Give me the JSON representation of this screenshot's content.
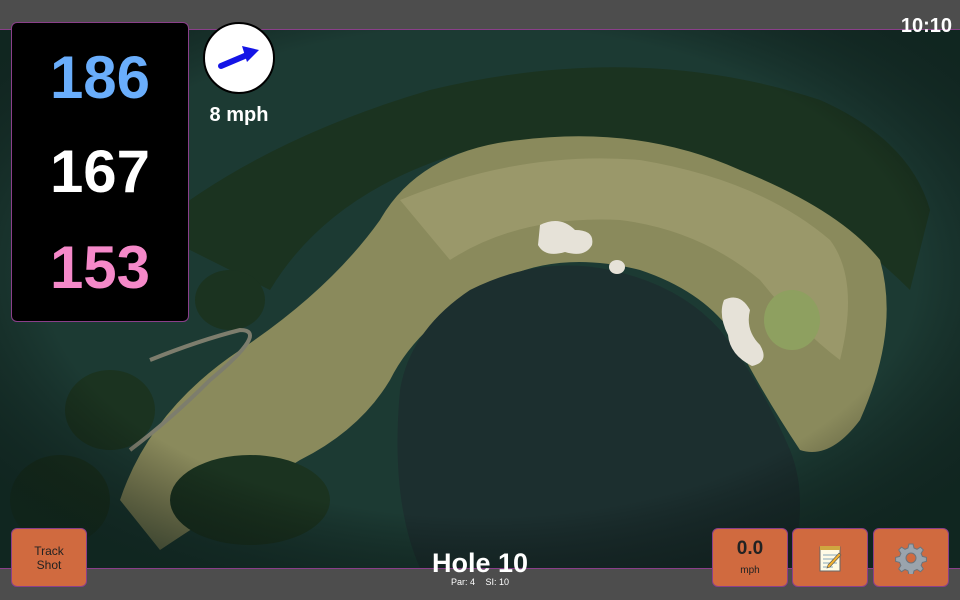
{
  "clock": "10:10",
  "distances": {
    "back": "186",
    "middle": "167",
    "front": "153"
  },
  "wind": {
    "speed": "8 mph",
    "icon": "wind-arrow-icon"
  },
  "buttons": {
    "track_shot": "Track\nShot",
    "speed_value": "0.0",
    "speed_unit": "mph",
    "notes_icon": "notepad-icon",
    "settings_icon": "gear-icon"
  },
  "hole": {
    "title": "Hole 10",
    "par": "Par: 4",
    "si": "SI: 10"
  },
  "colors": {
    "back": "#6aaefc",
    "middle": "#ffffff",
    "front": "#f589c9",
    "wind_speed": "#ffffff",
    "button": "#d06a3f",
    "accent_border": "#8a3f8a"
  }
}
